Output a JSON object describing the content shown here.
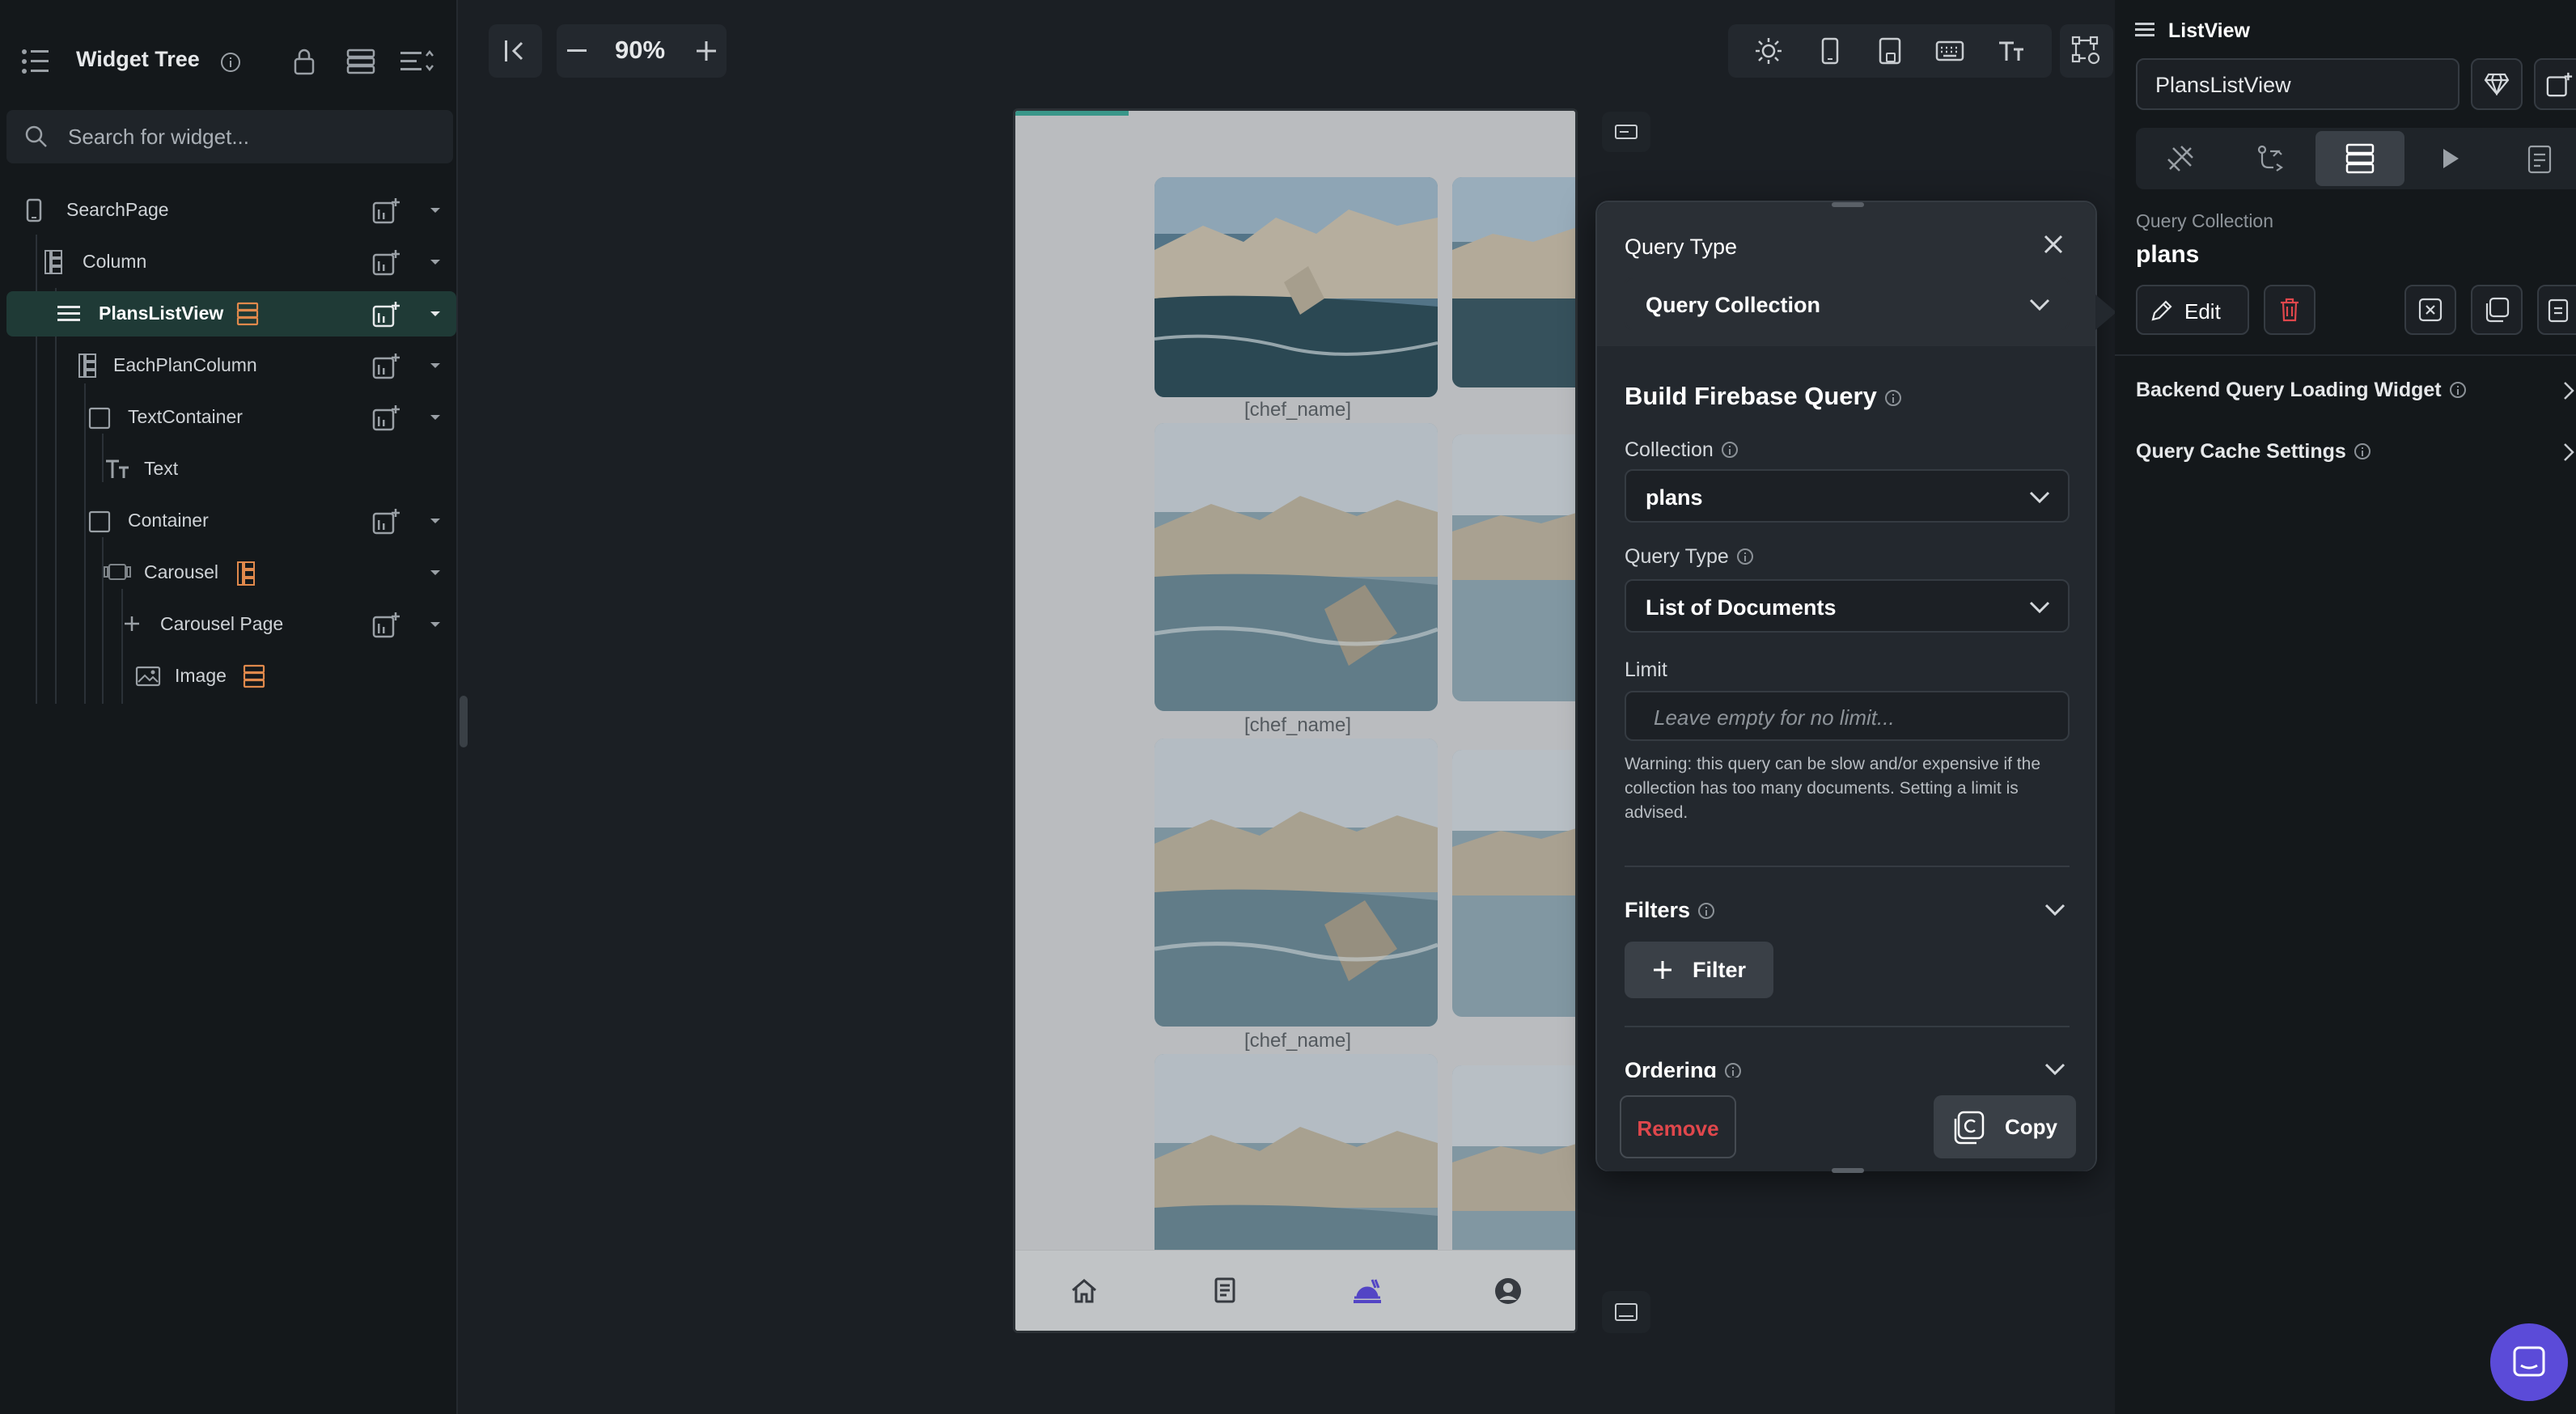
{
  "left_panel": {
    "title": "Widget Tree",
    "search_placeholder": "Search for widget...",
    "tree": [
      {
        "label": "SearchPage"
      },
      {
        "label": "Column"
      },
      {
        "label": "PlansListView",
        "selected": true
      },
      {
        "label": "EachPlanColumn"
      },
      {
        "label": "TextContainer"
      },
      {
        "label": "Text"
      },
      {
        "label": "Container"
      },
      {
        "label": "Carousel"
      },
      {
        "label": "Carousel Page"
      },
      {
        "label": "Image"
      }
    ]
  },
  "toolbar": {
    "zoom": "90%"
  },
  "phone": {
    "chef_label": "[chef_name]",
    "nav_active": "cart-chef"
  },
  "query_panel": {
    "header_label": "Query Type",
    "header_value": "Query Collection",
    "section_title": "Build Firebase Query",
    "collection_label": "Collection",
    "collection_value": "plans",
    "query_type_label": "Query Type",
    "query_type_value": "List of Documents",
    "limit_label": "Limit",
    "limit_placeholder": "Leave empty for no limit...",
    "warning": "Warning: this query can be slow and/or expensive if the collection has too many documents. Setting a limit is advised.",
    "filters_label": "Filters",
    "filter_button": "Filter",
    "ordering_label": "Ordering",
    "remove_button": "Remove",
    "copy_button": "Copy"
  },
  "right_panel": {
    "widget_type": "ListView",
    "widget_name": "PlansListView",
    "query_caption": "Query Collection",
    "query_value": "plans",
    "edit_button": "Edit",
    "backend_loading": "Backend Query Loading Widget",
    "cache_settings": "Query Cache Settings"
  },
  "colors": {
    "accent": "#3ea596",
    "danger": "#e0474c",
    "brand_purple": "#5b4bd8"
  }
}
